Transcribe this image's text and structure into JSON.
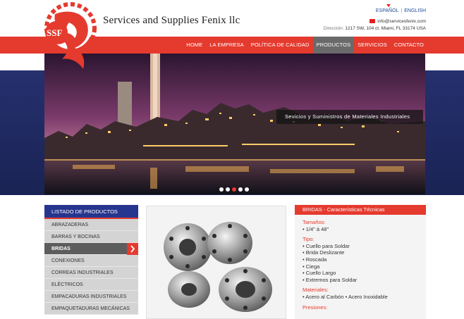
{
  "header": {
    "logo_text": "SSF",
    "title": "Services and Supplies Fenix llc",
    "lang_es": "ESPAÑOL",
    "lang_sep": "|",
    "lang_en": "ENGLISH",
    "email": "info@servicesfenix.com",
    "address_label": "Dirección:",
    "address": "1217 SW, 104 ct. Miami, FL 33174 USA"
  },
  "nav": {
    "items": [
      {
        "label": "HOME"
      },
      {
        "label": "LA EMPRESA"
      },
      {
        "label": "POLÍTICA DE CALIDAD"
      },
      {
        "label": "PRODUCTOS",
        "active": true
      },
      {
        "label": "SERVICIOS"
      },
      {
        "label": "CONTACTO"
      }
    ]
  },
  "hero": {
    "caption": "Sevicios y Suministros de Materiales Industriales",
    "slides": 5,
    "active_slide": 3
  },
  "products": {
    "heading": "LISTADO DE PRODUCTOS",
    "items": [
      {
        "label": "ABRAZADERAS"
      },
      {
        "label": "BARRAS Y BOCINAS"
      },
      {
        "label": "BRIDAS",
        "active": true
      },
      {
        "label": "CONEXIONES"
      },
      {
        "label": "CORREAS INDUSTRIALES"
      },
      {
        "label": "ELÉCTRICOS"
      },
      {
        "label": "EMPACADURAS INDUSTRIALES"
      },
      {
        "label": "EMPAQUETADURAS MECÁNICAS"
      }
    ]
  },
  "specs": {
    "heading": "BRIDAS - Características  Técnicas",
    "tamanos_title": "Tamaños:",
    "tamanos": "• 1/4\" á 48\"",
    "tipo_title": "Tipo:",
    "tipo": [
      "• Cuello para Soldar",
      "• Brida Deslizante",
      "• Roscada",
      "• Ciega",
      "• Cuello Largo",
      "• Extremos para Soldar"
    ],
    "materiales_title": "Materiales:",
    "materiales": "• Acero al Carbón • Acero Inoxidable",
    "presiones_title": "Presiones:"
  },
  "colors": {
    "brand_red": "#e53a2e",
    "brand_blue": "#26358e",
    "nav_active": "#6a6a6a"
  }
}
